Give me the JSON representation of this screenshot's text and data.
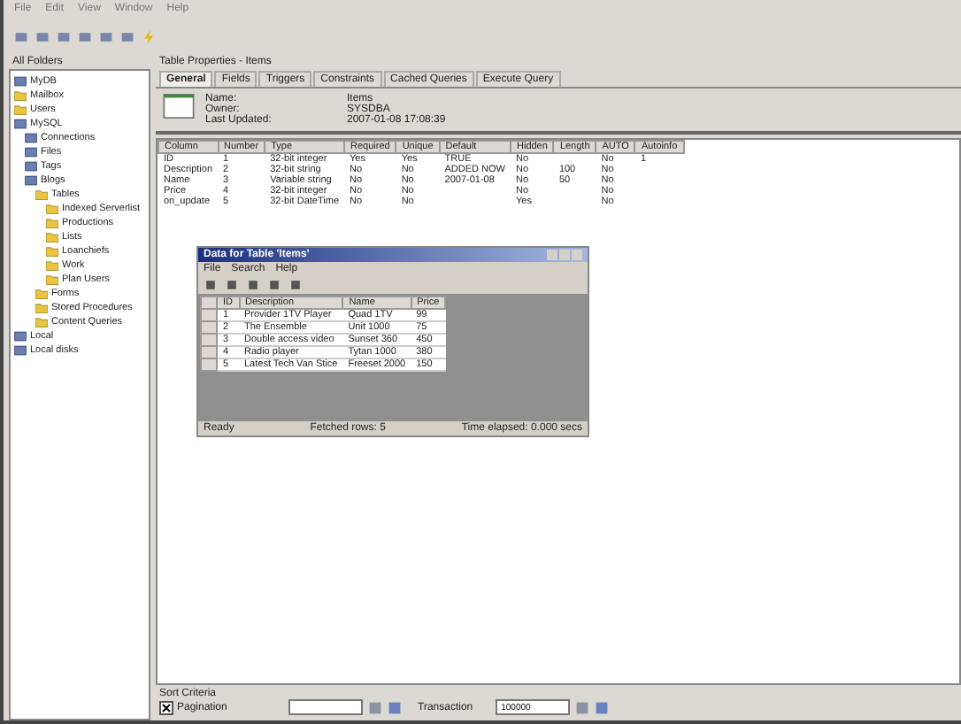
{
  "menu": [
    "File",
    "Edit",
    "View",
    "Window",
    "Help"
  ],
  "tree": {
    "title": "All Folders",
    "items": [
      {
        "label": "MyDB",
        "kind": "database"
      },
      {
        "label": "Mailbox",
        "kind": "folder"
      },
      {
        "label": "Users",
        "kind": "folder"
      },
      {
        "label": "MySQL",
        "kind": "database",
        "children": [
          {
            "label": "Connections",
            "kind": "database"
          },
          {
            "label": "Files",
            "kind": "database"
          },
          {
            "label": "Tags",
            "kind": "database"
          },
          {
            "label": "Blogs",
            "kind": "database",
            "children": [
              {
                "label": "Tables",
                "kind": "folder",
                "children": [
                  {
                    "label": "Indexed Serverlist",
                    "kind": "folder"
                  },
                  {
                    "label": "Productions",
                    "kind": "folder"
                  },
                  {
                    "label": "Lists",
                    "kind": "folder"
                  },
                  {
                    "label": "Loanchiefs",
                    "kind": "folder"
                  },
                  {
                    "label": "Work",
                    "kind": "folder"
                  },
                  {
                    "label": "Plan Users",
                    "kind": "folder"
                  }
                ]
              },
              {
                "label": "Forms",
                "kind": "folder"
              },
              {
                "label": "Stored Procedures",
                "kind": "folder"
              },
              {
                "label": "Content Queries",
                "kind": "folder"
              }
            ]
          }
        ]
      },
      {
        "label": "Local",
        "kind": "database"
      },
      {
        "label": "Local disks",
        "kind": "database"
      }
    ]
  },
  "panel_title": "Table Properties - Items",
  "tabs": [
    {
      "label": "General",
      "selected": true
    },
    {
      "label": "Fields",
      "selected": false
    },
    {
      "label": "Triggers",
      "selected": false
    },
    {
      "label": "Constraints",
      "selected": false
    },
    {
      "label": "Cached Queries",
      "selected": false
    },
    {
      "label": "Execute Query",
      "selected": false
    }
  ],
  "info": [
    {
      "label": "Name:",
      "value": "Items"
    },
    {
      "label": "Owner:",
      "value": "SYSDBA"
    },
    {
      "label": "Last Updated:",
      "value": "2007-01-08 17:08:39"
    }
  ],
  "fields_table": {
    "columns": [
      "Column",
      "Number",
      "Type",
      "Required",
      "Unique",
      "Default",
      "Hidden",
      "Length",
      "AUTO",
      "Autoinfo"
    ],
    "rows": [
      [
        "ID",
        "1",
        "32-bit integer",
        "Yes",
        "Yes",
        "TRUE",
        "No",
        null,
        "No",
        "1"
      ],
      [
        "Description",
        "2",
        "32-bit string",
        "No",
        "No",
        "ADDED NOW",
        "No",
        "100",
        "No",
        null
      ],
      [
        "Name",
        "3",
        "Variable string",
        "No",
        "No",
        "2007-01-08",
        "No",
        "50",
        "No",
        null
      ],
      [
        "Price",
        "4",
        "32-bit integer",
        "No",
        "No",
        null,
        "No",
        null,
        "No",
        null
      ],
      [
        "on_update",
        "5",
        "32-bit DateTime",
        "No",
        "No",
        null,
        "Yes",
        null,
        "No",
        null
      ]
    ]
  },
  "child_window": {
    "title": "Data for Table 'Items'",
    "menu": [
      "File",
      "Search",
      "Help"
    ],
    "columns": [
      "ID",
      "Description",
      "Name",
      "Price"
    ],
    "rows": [
      [
        "1",
        "Provider 1TV Player",
        "Quad 1TV",
        "99"
      ],
      [
        "2",
        "The Ensemble",
        "Unit 1000",
        "75"
      ],
      [
        "3",
        "Double access video",
        "Sunset 360",
        "450"
      ],
      [
        "4",
        "Radio player",
        "Tytan 1000",
        "380"
      ],
      [
        "5",
        "Latest Tech Van Stice",
        "Freeset 2000",
        "150"
      ]
    ],
    "status": [
      "Ready",
      "Fetched rows: 5",
      "Time elapsed: 0.000 secs"
    ]
  },
  "sort": {
    "title": "Sort Criteria",
    "checkbox": {
      "label": "Pagination",
      "checked": true
    },
    "transaction_label": "Transaction",
    "field_2": {
      "value": "100000"
    }
  }
}
